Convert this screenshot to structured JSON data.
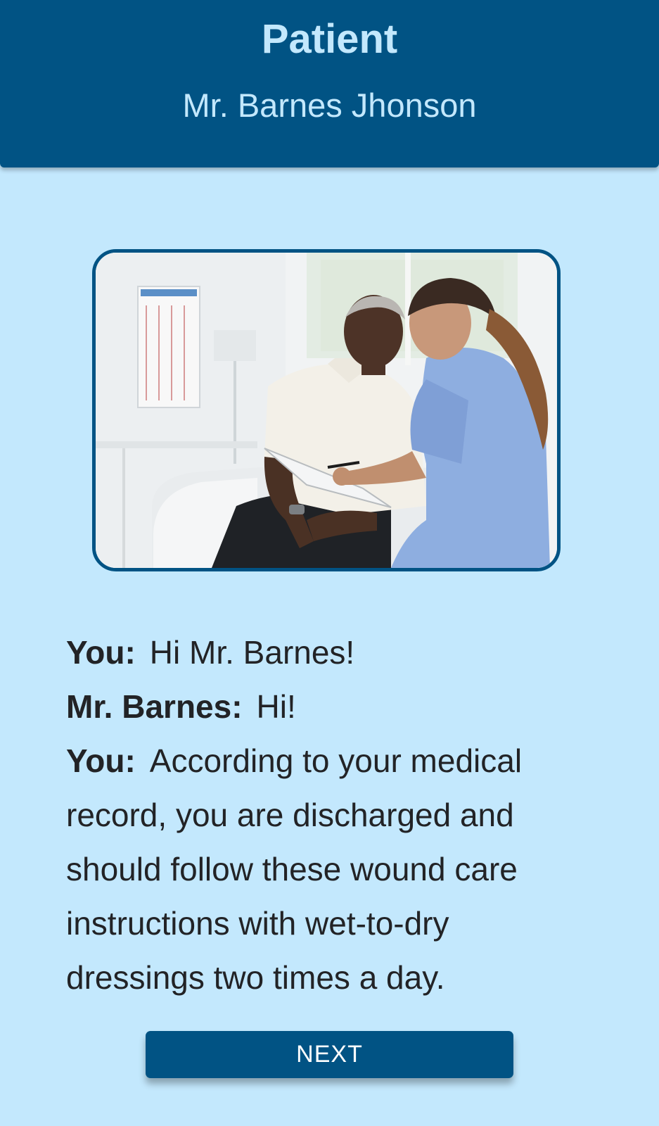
{
  "header": {
    "title": "Patient",
    "subtitle": "Mr. Barnes Jhonson"
  },
  "photo": {
    "icon": "clinic-photo"
  },
  "dialogue": [
    {
      "speaker": "You:",
      "text": "Hi Mr. Barnes!"
    },
    {
      "speaker": "Mr. Barnes:",
      "text": "Hi!"
    },
    {
      "speaker": "You:",
      "text": "According to your medical record, you are discharged and should follow these wound care instructions with wet-to-dry dressings two times a day."
    }
  ],
  "actions": {
    "next_label": "NEXT"
  },
  "colors": {
    "background": "#c3e8fd",
    "primary": "#015384",
    "header_text": "#c3e8fd",
    "body_text": "#222326",
    "button_text": "#ffffff"
  }
}
